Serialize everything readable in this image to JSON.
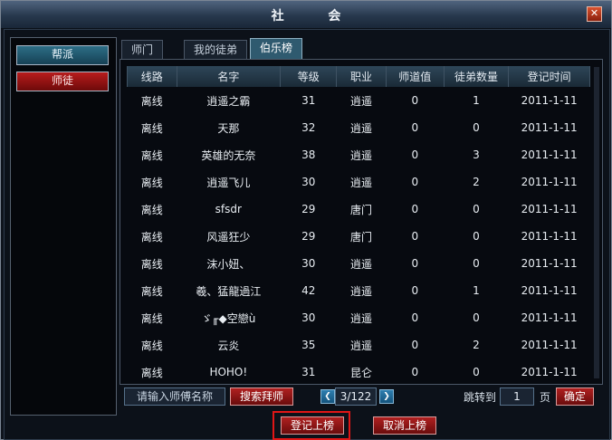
{
  "window": {
    "title": "社 会",
    "close_glyph": "✕"
  },
  "sidebar": {
    "items": [
      {
        "label": "帮派"
      },
      {
        "label": "师徒"
      }
    ]
  },
  "tabs": [
    {
      "label": "师门"
    },
    {
      "label": "我的徒弟"
    },
    {
      "label": "伯乐榜"
    }
  ],
  "table": {
    "columns": [
      "线路",
      "名字",
      "等级",
      "职业",
      "师道值",
      "徒弟数量",
      "登记时间"
    ],
    "rows": [
      [
        "离线",
        "逍遥之霸",
        "31",
        "逍遥",
        "0",
        "1",
        "2011-1-11"
      ],
      [
        "离线",
        "天那",
        "32",
        "逍遥",
        "0",
        "0",
        "2011-1-11"
      ],
      [
        "离线",
        "英雄的无奈",
        "38",
        "逍遥",
        "0",
        "3",
        "2011-1-11"
      ],
      [
        "离线",
        "逍遥飞儿",
        "30",
        "逍遥",
        "0",
        "2",
        "2011-1-11"
      ],
      [
        "离线",
        "sfsdr",
        "29",
        "唐门",
        "0",
        "0",
        "2011-1-11"
      ],
      [
        "离线",
        "风遥狂少",
        "29",
        "唐门",
        "0",
        "0",
        "2011-1-11"
      ],
      [
        "离线",
        "沫小妞、",
        "30",
        "逍遥",
        "0",
        "0",
        "2011-1-11"
      ],
      [
        "离线",
        "羲、猛龍過江",
        "42",
        "逍遥",
        "0",
        "1",
        "2011-1-11"
      ],
      [
        "离线",
        "ゞ╓◆空戀ù",
        "30",
        "逍遥",
        "0",
        "0",
        "2011-1-11"
      ],
      [
        "离线",
        "云炎",
        "35",
        "逍遥",
        "0",
        "2",
        "2011-1-11"
      ],
      [
        "离线",
        "HOHO!",
        "31",
        "昆仑",
        "0",
        "0",
        "2011-1-11"
      ]
    ]
  },
  "search": {
    "placeholder": "请输入师傅名称",
    "button_label": "搜索拜师"
  },
  "pagination": {
    "current": 3,
    "total": 122,
    "display": "3/122",
    "prev_glyph": "❮",
    "next_glyph": "❯"
  },
  "jump": {
    "label": "跳转到",
    "value": "1",
    "suffix": "页",
    "confirm_label": "确定"
  },
  "actions": {
    "register_label": "登记上榜",
    "cancel_label": "取消上榜"
  }
}
